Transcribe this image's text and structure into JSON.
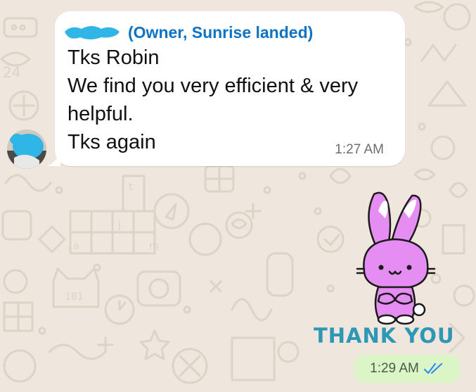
{
  "chat": {
    "background_color": "#efe7dd",
    "doodle_color": "#ddd3c6"
  },
  "incoming_message": {
    "sender_role": "(Owner, Sunrise landed)",
    "lines": [
      "Tks Robin",
      "We find you very efficient & very",
      "helpful.",
      "Tks again"
    ],
    "time": "1:27 AM",
    "sender_name_color": "#0f73c4",
    "redaction_color": "#2fb6e6"
  },
  "sticker": {
    "icon": "pink-bunny-thank-you-sticker",
    "text": "THANK YOU",
    "text_color": "#2d97b5",
    "bunny_color": "#e68df3"
  },
  "outgoing_status": {
    "time": "1:29 AM",
    "ticks_icon": "double-check-read-icon",
    "ticks_color": "#2e8ef0",
    "bubble_color": "#dcf5c6"
  }
}
